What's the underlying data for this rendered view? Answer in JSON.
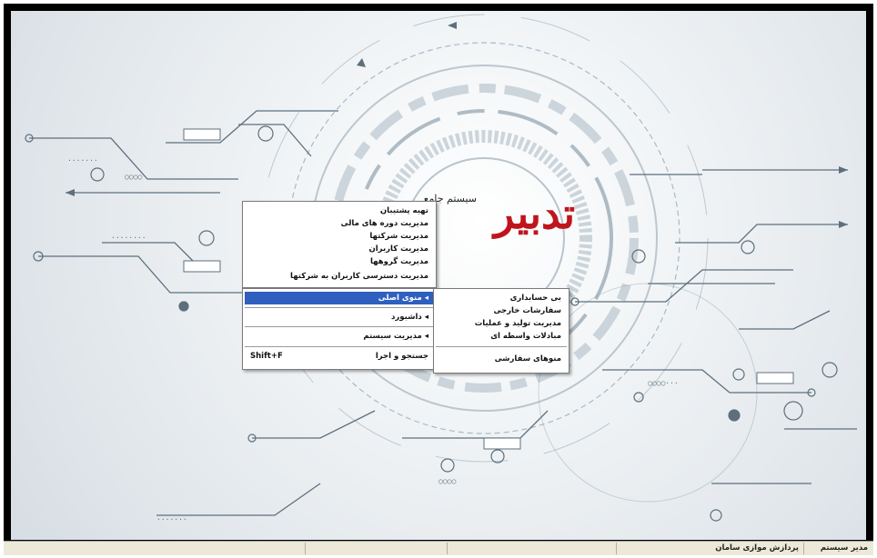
{
  "logo": {
    "brand": "تدبیر",
    "caption": "سیستم جامع"
  },
  "menus": {
    "top": {
      "items": [
        {
          "label": "تهیه پشتیبان"
        },
        {
          "label": "مدیریت دوره های مالی"
        },
        {
          "label": "مدیریت شرکتها"
        },
        {
          "label": "مدیریت کاربران"
        },
        {
          "label": "مدیریت گروهها"
        },
        {
          "label": "مدیریت دسترسی کاربران به شرکتها"
        }
      ]
    },
    "main": {
      "items": [
        {
          "label": "منوی اصلی",
          "arrow": "◂"
        },
        {
          "label": "داشبورد",
          "arrow": "◂"
        },
        {
          "label": "مدیریت سیستم",
          "arrow": "◂"
        },
        {
          "label": "جستجو و اجرا",
          "shortcut": "Shift+F"
        }
      ]
    },
    "sub": {
      "items": [
        {
          "label": "بی حسابداری"
        },
        {
          "label": "سفارشات خارجی"
        },
        {
          "label": "مدیریت تولید و عملیات"
        },
        {
          "label": "مبادلات واسطه ای"
        },
        {
          "label": "منوهای سفارشی"
        }
      ]
    }
  },
  "statusbar": {
    "user": "مدیر سیستم",
    "company": "پردازش موازی سامان"
  },
  "colors": {
    "highlight": "#2f5fbf",
    "logo_red": "#c0141c",
    "circuit": "#5d6f7d"
  }
}
